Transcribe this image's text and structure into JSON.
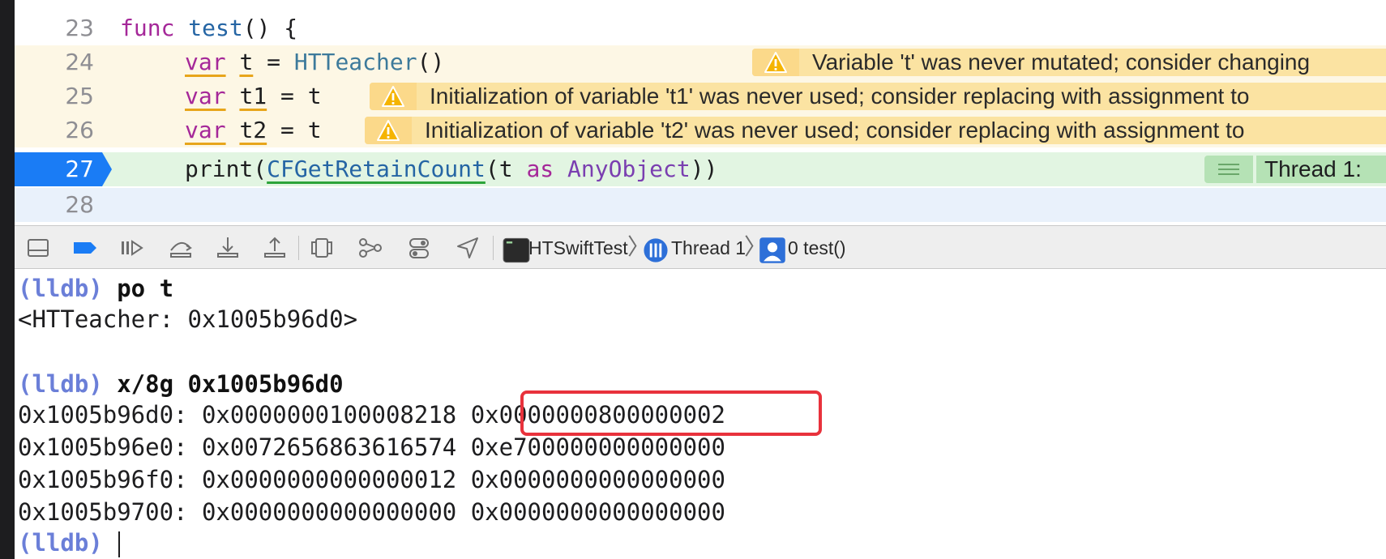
{
  "editor": {
    "lines": [
      {
        "num": "23",
        "kw": "func",
        "fn": "test",
        "rest": "() {"
      },
      {
        "num": "24",
        "kw": "var",
        "name": "t",
        "eq": " = ",
        "type": "HTTeacher",
        "rest": "()"
      },
      {
        "num": "25",
        "kw": "var",
        "name": "t1",
        "rest": " = t"
      },
      {
        "num": "26",
        "kw": "var",
        "name": "t2",
        "rest": " = t"
      },
      {
        "num": "27",
        "fn": "print",
        "p1": "(",
        "call": "CFGetRetainCount",
        "p2": "(t ",
        "kw": "as",
        "type": "AnyObject",
        "p3": "))"
      },
      {
        "num": "28"
      }
    ],
    "warnings": [
      {
        "line": "24",
        "text": "Variable 't' was never mutated; consider changing"
      },
      {
        "line": "25",
        "text": "Initialization of variable 't1' was never used; consider replacing with assignment to"
      },
      {
        "line": "26",
        "text": "Initialization of variable 't2' was never used; consider replacing with assignment to"
      }
    ],
    "thread_banner": "Thread 1:",
    "colors": {
      "warning": "#fbe3a2",
      "current_line": "#e2f5e2",
      "pc_marker": "#1a7cf5"
    }
  },
  "debugbar": {
    "icons": [
      "hide-debug-area-icon",
      "breakpoints-icon",
      "continue-icon",
      "step-over-icon",
      "step-into-icon",
      "step-out-icon",
      "view-hierarchy-icon",
      "memory-graph-icon",
      "environment-overrides-icon",
      "simulate-location-icon"
    ],
    "breadcrumb": {
      "process": "HTSwiftTest",
      "thread": "Thread 1",
      "frame": "0 test()"
    }
  },
  "console": {
    "lines": [
      {
        "prompt": "(lldb)",
        "cmd": " po t"
      },
      {
        "text": "<HTTeacher: 0x1005b96d0>"
      },
      {
        "text": ""
      },
      {
        "prompt": "(lldb)",
        "cmd": " x/8g 0x1005b96d0"
      },
      {
        "text": "0x1005b96d0: 0x0000000100008218 0x0000000800000002"
      },
      {
        "text": "0x1005b96e0: 0x0072656863616574 0xe700000000000000"
      },
      {
        "text": "0x1005b96f0: 0x0000000000000012 0x0000000000000000"
      },
      {
        "text": "0x1005b9700: 0x0000000000000000 0x0000000000000000"
      },
      {
        "prompt": "(lldb)",
        "cmd": " "
      }
    ]
  }
}
